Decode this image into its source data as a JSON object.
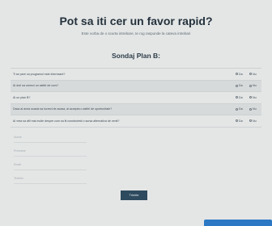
{
  "header": {
    "title": "Pot sa iti cer un favor rapid?",
    "subtitle": "Este vorba de o scurta intrebare, te rog raspunde la cateva intrebari"
  },
  "survey": {
    "title": "Sondaj Plan B:",
    "yes_label": "Da",
    "no_label": "Nu",
    "questions": [
      "Ti se pare ca programul este interesant?",
      "Ai dori sa urmezi un astfel de curs?",
      "Ai un plan B?",
      "Daca ai avea ocazia sa lucrezi de acasa, ai accepta o astfel de oportunitate?",
      "Ai vrea sa afli mai multe despre cum sa iti construiesti o sursa alternativa de venit?"
    ]
  },
  "form": {
    "fields": [
      "Nume",
      "Prenume",
      "Email",
      "Telefon"
    ],
    "submit_label": "Trimite"
  },
  "colors": {
    "background": "#e4e6e6",
    "submit": "#2e4a5e",
    "chat_tab": "#2c78c4"
  }
}
